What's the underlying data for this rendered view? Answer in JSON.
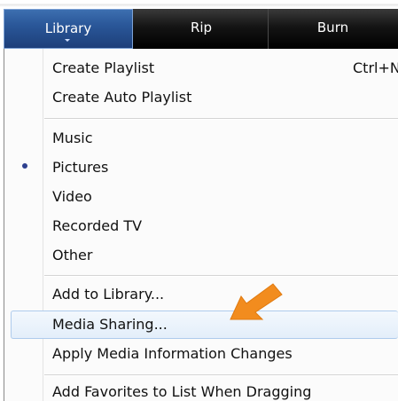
{
  "toolbar": {
    "tabs": [
      {
        "label": "Library"
      },
      {
        "label": "Rip"
      },
      {
        "label": "Burn"
      }
    ]
  },
  "menu": {
    "items": [
      {
        "label": "Create Playlist",
        "shortcut": "Ctrl+N"
      },
      {
        "label": "Create Auto Playlist"
      },
      {
        "label": "Music"
      },
      {
        "label": "Pictures",
        "selected": true
      },
      {
        "label": "Video"
      },
      {
        "label": "Recorded TV"
      },
      {
        "label": "Other"
      },
      {
        "label": "Add to Library..."
      },
      {
        "label": "Media Sharing...",
        "highlighted": true
      },
      {
        "label": "Apply Media Information Changes"
      },
      {
        "label": "Add Favorites to List When Dragging"
      }
    ]
  },
  "annotation": {
    "icon": "orange-arrow-icon",
    "color": "#f28c1e"
  },
  "colors": {
    "accent": "#2a5799",
    "highlight": "#e3eefa",
    "selection_dot": "#2d3f8f"
  }
}
